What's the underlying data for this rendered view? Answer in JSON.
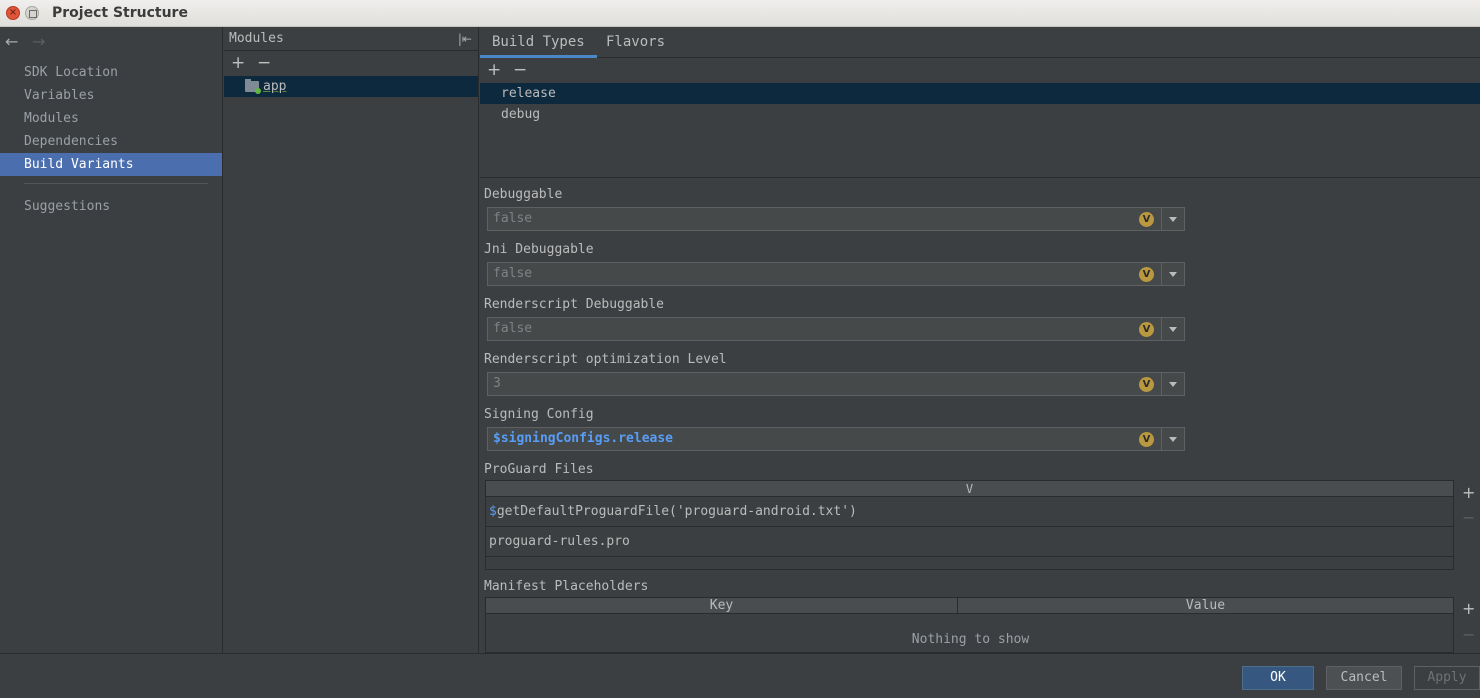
{
  "window": {
    "title": "Project Structure"
  },
  "sidebar": {
    "items": [
      {
        "label": "SDK Location"
      },
      {
        "label": "Variables"
      },
      {
        "label": "Modules"
      },
      {
        "label": "Dependencies"
      },
      {
        "label": "Build Variants",
        "selected": true
      }
    ],
    "suggestions_label": "Suggestions"
  },
  "modules_panel": {
    "header": "Modules",
    "add_label": "+",
    "remove_label": "−",
    "modules": [
      {
        "label": "app"
      }
    ]
  },
  "tabs": [
    {
      "label": "Build Types",
      "active": true
    },
    {
      "label": "Flavors"
    }
  ],
  "build_types": {
    "add_label": "+",
    "remove_label": "−",
    "items": [
      {
        "label": "release",
        "selected": true
      },
      {
        "label": "debug"
      }
    ]
  },
  "fields": {
    "debuggable": {
      "label": "Debuggable",
      "value": "false"
    },
    "jni_debuggable": {
      "label": "Jni Debuggable",
      "value": "false"
    },
    "renderscript_debuggable": {
      "label": "Renderscript Debuggable",
      "value": "false"
    },
    "renderscript_opt_level": {
      "label": "Renderscript optimization Level",
      "value": "3"
    },
    "signing_config": {
      "label": "Signing Config",
      "value": "$signingConfigs.release"
    },
    "badge": "V"
  },
  "proguard": {
    "label": "ProGuard Files",
    "column": "V",
    "rows": [
      {
        "prefix": "$",
        "text": "getDefaultProguardFile('proguard-android.txt')"
      },
      {
        "prefix": "",
        "text": "proguard-rules.pro"
      }
    ],
    "add_label": "+",
    "remove_label": "−"
  },
  "manifest_placeholders": {
    "label": "Manifest Placeholders",
    "columns": {
      "key": "Key",
      "value": "Value"
    },
    "empty_text": "Nothing to show",
    "add_label": "+",
    "remove_label": "−"
  },
  "footer": {
    "ok": "OK",
    "cancel": "Cancel",
    "apply": "Apply"
  },
  "colors": {
    "selection": "#4b6eaf",
    "row_selection": "#0d293e",
    "reference": "#589df6",
    "badge": "#b99840"
  }
}
